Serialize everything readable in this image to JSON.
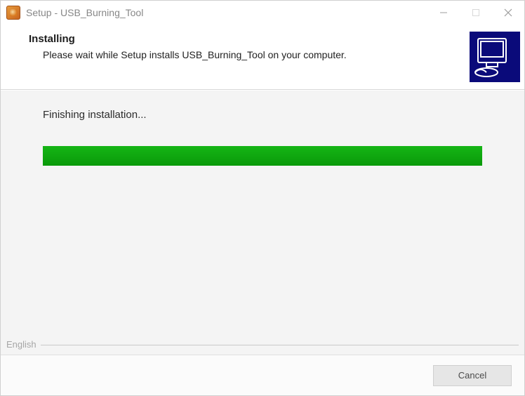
{
  "titlebar": {
    "title": "Setup - USB_Burning_Tool"
  },
  "header": {
    "heading": "Installing",
    "subtext": "Please wait while Setup installs USB_Burning_Tool on your computer."
  },
  "body": {
    "status": "Finishing installation...",
    "progress_percent": 100
  },
  "language": {
    "label": "English"
  },
  "footer": {
    "cancel_label": "Cancel"
  },
  "colors": {
    "progress_fill": "#0da80d",
    "header_icon_bg": "#0a0a7a"
  }
}
